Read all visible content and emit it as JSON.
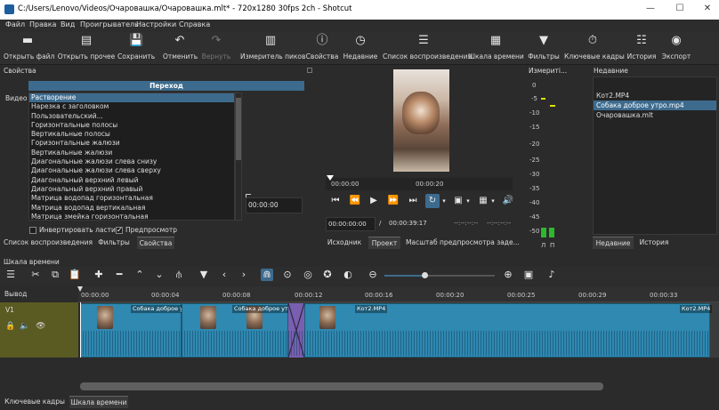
{
  "window": {
    "title": "C:/Users/Lenovo/Videos/Очаровашка/Очаровашка.mlt* - 720x1280 30fps 2ch - Shotcut",
    "min": "—",
    "max": "☐",
    "close": "✕"
  },
  "menu": [
    "Файл",
    "Правка",
    "Вид",
    "Проигрыватель",
    "Настройки",
    "Справка"
  ],
  "toolbar": [
    {
      "label": "Открыть файл",
      "icon": "▬"
    },
    {
      "label": "Открыть прочее",
      "icon": "▤"
    },
    {
      "label": "Сохранить",
      "icon": "💾"
    },
    {
      "label": "Отменить",
      "icon": "↶"
    },
    {
      "label": "Вернуть",
      "icon": "↷"
    },
    {
      "label": "Измеритель пиков",
      "icon": "▥"
    },
    {
      "label": "Свойства",
      "icon": "ⓘ"
    },
    {
      "label": "Недавние",
      "icon": "◷"
    },
    {
      "label": "Список воспроизведения",
      "icon": "☰"
    },
    {
      "label": "Шкала времени",
      "icon": "▦"
    },
    {
      "label": "Фильтры",
      "icon": "▼"
    },
    {
      "label": "Ключевые кадры",
      "icon": "⏱"
    },
    {
      "label": "История",
      "icon": "☷"
    },
    {
      "label": "Экспорт",
      "icon": "◉"
    }
  ],
  "properties": {
    "panel_title": "Свойства",
    "section_title": "Переход",
    "video_label": "Видео",
    "transitions": [
      "Растворение",
      "Нарезка с заголовком",
      "Пользовательский...",
      "Горизонтальные полосы",
      "Вертикальные полосы",
      "Горизонтальные жалюзи",
      "Вертикальные жалюзи",
      "Диагональные жалюзи слева снизу",
      "Диагональные жалюзи слева сверху",
      "Диагональный верхний левый",
      "Диагональный верхний правый",
      "Матрица водопад горизонтальная",
      "Матрица водопад вертикальная",
      "Матрица змейка горизонтальная"
    ],
    "softness_time": "00:00:00",
    "invert_label": "Инвертировать ластик",
    "preview_label": "Предпросмотр",
    "tabs": [
      "Список воспроизведения",
      "Фильтры",
      "Свойства"
    ]
  },
  "player": {
    "ruler_start": "00:00:00",
    "ruler_mid": "00:00:20",
    "position": "00:00:00:00",
    "separator": "/",
    "duration": "00:00:39:17",
    "in_point": "--:--:--:--",
    "out_point": "--:--:--:--",
    "tabs": [
      "Исходник",
      "Проект",
      "Масштаб предпросмотра заде..."
    ]
  },
  "meter": {
    "title": "Измериті...",
    "scale": [
      "0",
      "-5",
      "-10",
      "-15",
      "-20",
      "-25",
      "-30",
      "-35",
      "-40",
      "-45",
      "-50"
    ],
    "channels": [
      "Л",
      "П"
    ],
    "colors": {
      "low": "#2eb82e",
      "mid": "#e0e000"
    }
  },
  "recent": {
    "title": "Недавние",
    "items": [
      "Кот2.MP4",
      "Собака доброе утро.mp4",
      "Очаровашка.mlt"
    ],
    "selected_index": 1,
    "tabs": [
      "Недавние",
      "История"
    ]
  },
  "timeline": {
    "title": "Шкала времени",
    "output_label": "Вывод",
    "track_label": "V1",
    "ticks": [
      "00:00:00",
      "00:00:04",
      "00:00:08",
      "00:00:12",
      "00:00:16",
      "00:00:20",
      "00:00:25",
      "00:00:29",
      "00:00:33"
    ],
    "clips": [
      {
        "name": "Собака доброе утро"
      },
      {
        "name": "Собака доброе утро"
      },
      {
        "name": "Кот2.MP4"
      },
      {
        "name": "Кот2.MP4"
      }
    ],
    "tools": [
      "☰",
      "✂",
      "⧉",
      "📋",
      "✚",
      "━",
      "⌃",
      "⌄",
      "⫛",
      "▼",
      "‹",
      "›",
      "⋒",
      "⊙",
      "◎",
      "✪",
      "◐",
      "⊖",
      "⊕",
      "▣",
      "♪"
    ]
  },
  "bottom_tabs": [
    "Ключевые кадры",
    "Шкала времени"
  ],
  "colors": {
    "accent": "#3d6b8e",
    "clip": "#2f89b1",
    "transition": "#7a5fb0"
  }
}
